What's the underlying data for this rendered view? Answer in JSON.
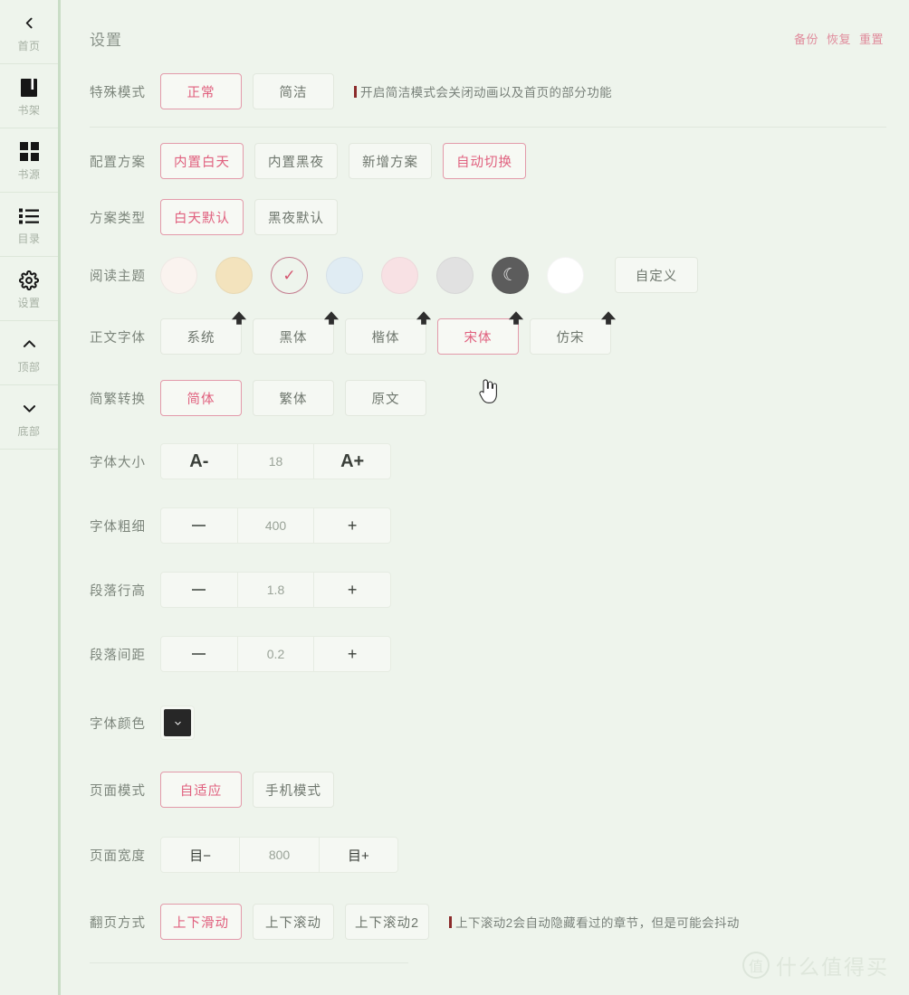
{
  "sidebar": {
    "items": [
      {
        "icon": "chevron-left-icon",
        "label": "首页"
      },
      {
        "icon": "book-icon",
        "label": "书架"
      },
      {
        "icon": "grid-icon",
        "label": "书源"
      },
      {
        "icon": "list-icon",
        "label": "目录"
      },
      {
        "icon": "gear-icon",
        "label": "设置"
      },
      {
        "icon": "chevron-up-icon",
        "label": "顶部"
      },
      {
        "icon": "chevron-down-icon",
        "label": "底部"
      }
    ]
  },
  "header": {
    "title": "设置",
    "actions": [
      {
        "label": "备份"
      },
      {
        "label": "恢复"
      },
      {
        "label": "重置"
      }
    ]
  },
  "rows": {
    "special_mode": {
      "label": "特殊模式",
      "options": [
        {
          "label": "正常",
          "selected": true
        },
        {
          "label": "简洁",
          "selected": false
        }
      ],
      "hint": "开启简洁模式会关闭动画以及首页的部分功能"
    },
    "config_scheme": {
      "label": "配置方案",
      "options": [
        {
          "label": "内置白天",
          "selected": true
        },
        {
          "label": "内置黑夜",
          "selected": false
        },
        {
          "label": "新增方案",
          "selected": false
        },
        {
          "label": "自动切换",
          "selected": true
        }
      ]
    },
    "scheme_type": {
      "label": "方案类型",
      "options": [
        {
          "label": "白天默认",
          "selected": true
        },
        {
          "label": "黑夜默认",
          "selected": false
        }
      ]
    },
    "reading_theme": {
      "label": "阅读主题",
      "swatches": [
        {
          "color": "#faf3ef",
          "selected": false,
          "glyph": ""
        },
        {
          "color": "#f3e3bd",
          "selected": false,
          "glyph": ""
        },
        {
          "color": "#eef4ec",
          "selected": true,
          "glyph": "✓"
        },
        {
          "color": "#e0ecf3",
          "selected": false,
          "glyph": ""
        },
        {
          "color": "#f8e1e4",
          "selected": false,
          "glyph": ""
        },
        {
          "color": "#e1e1e1",
          "selected": false,
          "glyph": ""
        },
        {
          "color": "#5c5c5c",
          "selected": false,
          "glyph": "☾"
        },
        {
          "color": "#ffffff",
          "selected": false,
          "glyph": ""
        }
      ],
      "custom_label": "自定义"
    },
    "body_font": {
      "label": "正文字体",
      "options": [
        {
          "label": "系统",
          "selected": false
        },
        {
          "label": "黑体",
          "selected": false
        },
        {
          "label": "楷体",
          "selected": false
        },
        {
          "label": "宋体",
          "selected": true
        },
        {
          "label": "仿宋",
          "selected": false
        }
      ],
      "badge_icon": "cloud-upload-icon"
    },
    "simp_trad": {
      "label": "简繁转换",
      "options": [
        {
          "label": "简体",
          "selected": true
        },
        {
          "label": "繁体",
          "selected": false
        },
        {
          "label": "原文",
          "selected": false
        }
      ]
    },
    "font_size": {
      "label": "字体大小",
      "dec": "A-",
      "value": "18",
      "inc": "A+",
      "dec_icon": "font-decrease-icon",
      "inc_icon": "font-increase-icon"
    },
    "font_weight": {
      "label": "字体粗细",
      "dec": "−",
      "value": "400",
      "inc": "+",
      "dec_icon": "minus-icon",
      "inc_icon": "plus-icon"
    },
    "line_height": {
      "label": "段落行高",
      "dec": "−",
      "value": "1.8",
      "inc": "+",
      "dec_icon": "minus-icon",
      "inc_icon": "plus-icon"
    },
    "para_spacing": {
      "label": "段落间距",
      "dec": "−",
      "value": "0.2",
      "inc": "+",
      "dec_icon": "minus-icon",
      "inc_icon": "plus-icon"
    },
    "font_color": {
      "label": "字体颜色",
      "color": "#272727",
      "icon": "chevron-down-icon"
    },
    "page_mode": {
      "label": "页面模式",
      "options": [
        {
          "label": "自适应",
          "selected": true
        },
        {
          "label": "手机模式",
          "selected": false
        }
      ]
    },
    "page_width": {
      "label": "页面宽度",
      "dec": "目−",
      "value": "800",
      "inc": "目+",
      "dec_icon": "width-decrease-icon",
      "inc_icon": "width-increase-icon"
    },
    "page_turn": {
      "label": "翻页方式",
      "options": [
        {
          "label": "上下滑动",
          "selected": true
        },
        {
          "label": "上下滚动",
          "selected": false
        },
        {
          "label": "上下滚动2",
          "selected": false
        }
      ],
      "hint": "上下滚动2会自动隐藏看过的章节，但是可能会抖动"
    }
  },
  "watermark": {
    "mark": "值",
    "text": "什么值得买"
  },
  "colors": {
    "background": "#eef4ec",
    "accent_pink": "#e0607e",
    "sidebar_edge": "#c9ddc6",
    "label_text": "#7c857b"
  }
}
